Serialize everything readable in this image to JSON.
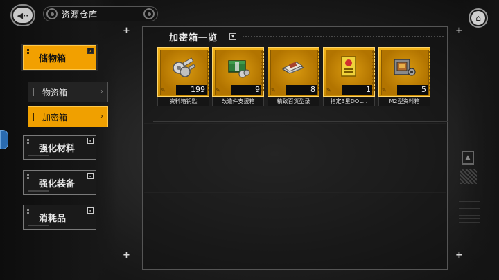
{
  "header": {
    "title": "资源仓库",
    "back_label": "◀··",
    "home_icon": "home-icon"
  },
  "sidebar": {
    "categories": [
      {
        "label": "储物箱"
      },
      {
        "label": "强化材料"
      },
      {
        "label": "强化装备"
      },
      {
        "label": "消耗品"
      }
    ],
    "sub_items": [
      {
        "label": "物资箱"
      },
      {
        "label": "加密箱"
      }
    ]
  },
  "panel": {
    "title": "加密箱一览",
    "items": [
      {
        "name": "资料箱钥匙",
        "count": "199",
        "icon": "key-icon"
      },
      {
        "name": "改造件支援箱",
        "count": "9",
        "icon": "supply-crate-icon"
      },
      {
        "name": "精致百货型录",
        "count": "8",
        "icon": "catalog-icon"
      },
      {
        "name": "指定3星DOL...",
        "count": "1",
        "icon": "doll-ticket-icon"
      },
      {
        "name": "M2型资料箱",
        "count": "5",
        "icon": "data-box-icon"
      }
    ]
  },
  "colors": {
    "accent": "#f2a000",
    "card_gold": "#d99a10"
  }
}
